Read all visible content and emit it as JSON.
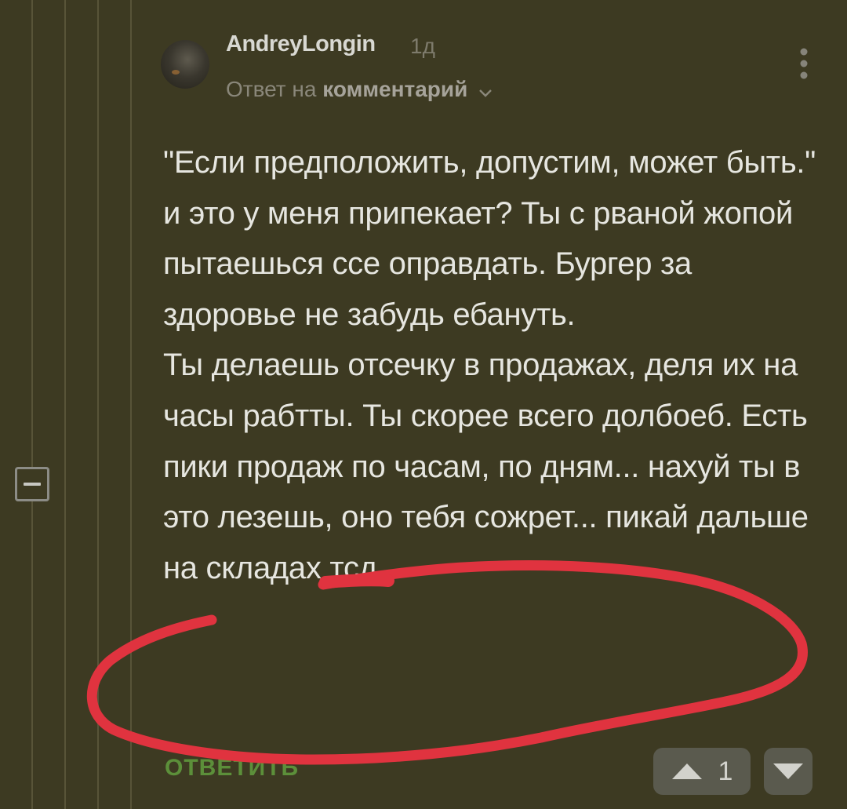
{
  "comment": {
    "author": "AndreyLongin",
    "age": "1д",
    "reply_prefix": "Ответ на",
    "reply_target": "комментарий",
    "paragraphs": [
      "\"Если предположить, допустим, может быть.\"",
      "и это у меня припекает? Ты с рваной жопой пытаешься ссе оправдать. Бургер за здоровье не забудь ебануть.",
      "Ты делаешь отсечку в продажах, деля их на часы рабтты. Ты скорее всего долбоеб. Есть пики продаж по часам, по дням... нахуй ты в это лезешь, оно тебя сожрет... пикай дальше на складах тсд..."
    ],
    "reply_button": "ОТВЕТИТЬ",
    "rating": "1"
  },
  "colors": {
    "background": "#3d3a22",
    "reply_button": "#5c8f3a",
    "annotation_circle": "#e0333f"
  },
  "icons": {
    "collapse": "minus-square-icon",
    "more": "vertical-dots-icon",
    "upvote": "triangle-up-icon",
    "downvote": "triangle-down-icon",
    "reply_chevron": "chevron-down-icon"
  }
}
